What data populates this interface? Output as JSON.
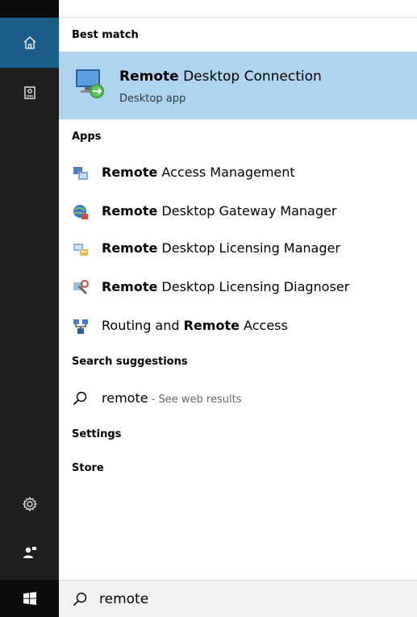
{
  "sections": {
    "best_match": "Best match",
    "apps": "Apps",
    "search_suggestions": "Search suggestions",
    "settings": "Settings",
    "store": "Store"
  },
  "best_match": {
    "title_bold": "Remote",
    "title_rest": " Desktop Connection",
    "subtitle": "Desktop app",
    "icon": "remote-desktop-connection-icon",
    "highlight_color": "#aed4f0"
  },
  "apps": [
    {
      "pre": "",
      "bold": "Remote",
      "post": " Access Management",
      "icon": "remote-access-management-icon"
    },
    {
      "pre": "",
      "bold": "Remote",
      "post": " Desktop Gateway Manager",
      "icon": "rd-gateway-manager-icon"
    },
    {
      "pre": "",
      "bold": "Remote",
      "post": " Desktop Licensing Manager",
      "icon": "rd-licensing-manager-icon"
    },
    {
      "pre": "",
      "bold": "Remote",
      "post": " Desktop Licensing Diagnoser",
      "icon": "rd-licensing-diagnoser-icon"
    },
    {
      "pre": "Routing and ",
      "bold": "Remote",
      "post": " Access",
      "icon": "routing-remote-access-icon"
    }
  ],
  "web_suggestion": {
    "term": "remote",
    "hint": " - See web results"
  },
  "search": {
    "value": "remote"
  },
  "rail": {
    "home_icon": "home-icon",
    "notebook_icon": "notebook-icon",
    "settings_icon": "gear-icon",
    "feedback_icon": "feedback-icon",
    "start_icon": "windows-start-icon",
    "accent": "#1b5e8a"
  }
}
